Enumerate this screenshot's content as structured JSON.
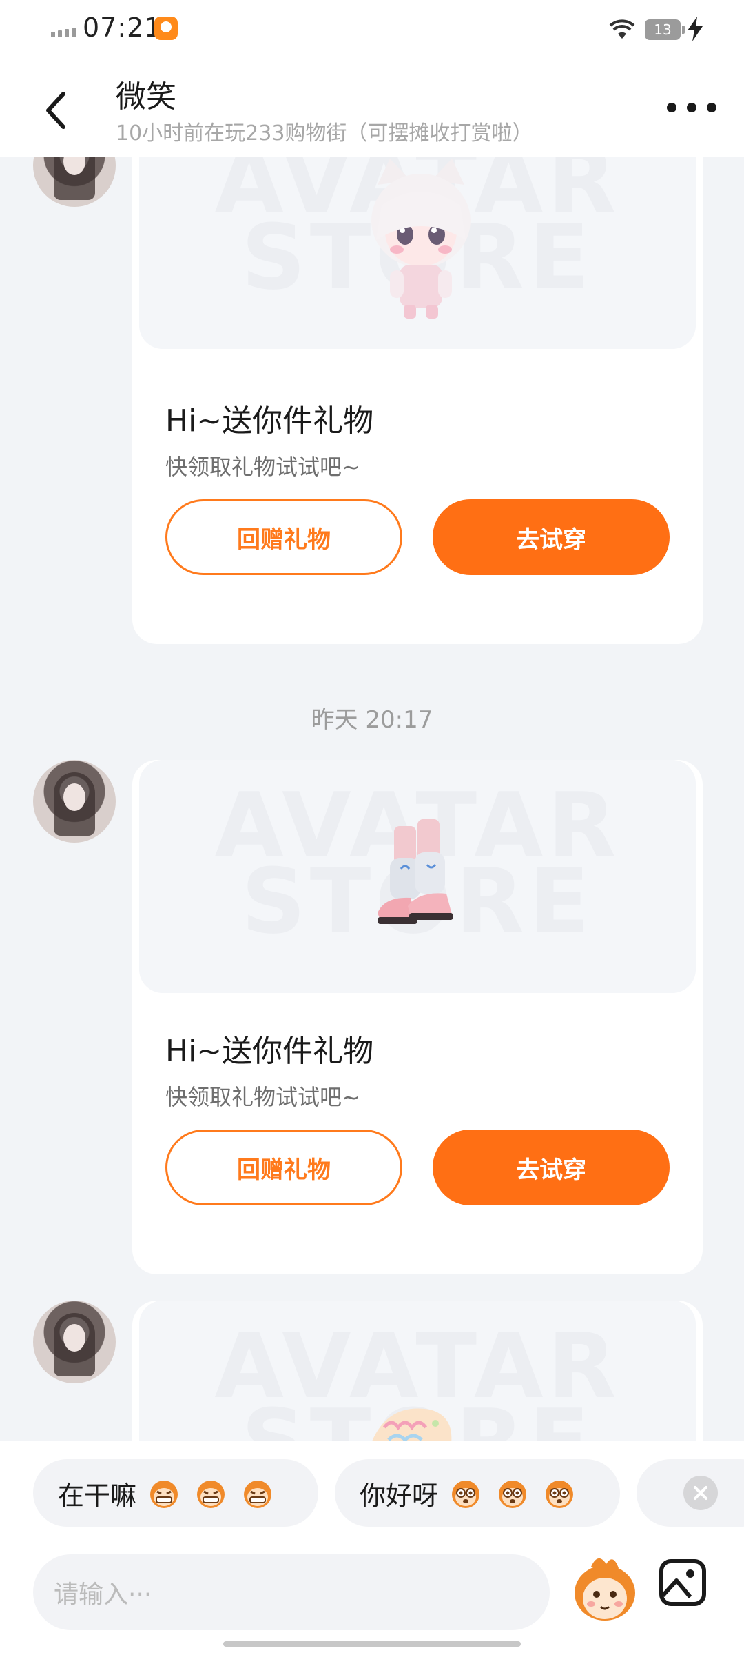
{
  "status_bar": {
    "time": "07:21",
    "battery_level": "13",
    "icons": [
      "signal-icon",
      "app-notification-icon",
      "wifi-icon",
      "battery-icon",
      "charging-icon"
    ]
  },
  "header": {
    "title": "微笑",
    "subtitle": "10小时前在玩233购物街（可摆摊收打赏啦）",
    "icons": [
      "back-icon",
      "more-icon"
    ]
  },
  "messages": [
    {
      "image_watermark": [
        "AVATAR",
        "STORE"
      ],
      "image_subject": "cat-ear-girl-avatar",
      "title": "Hi~送你件礼物",
      "description": "快领取礼物试试吧~",
      "return_gift_label": "回赠礼物",
      "try_on_label": "去试穿"
    },
    {
      "timestamp": "昨天 20:17",
      "image_watermark": [
        "AVATAR",
        "STORE"
      ],
      "image_subject": "leg-warmer-boots",
      "title": "Hi~送你件礼物",
      "description": "快领取礼物试试吧~",
      "return_gift_label": "回赠礼物",
      "try_on_label": "去试穿"
    },
    {
      "image_watermark": [
        "AVATAR",
        "STORE"
      ],
      "image_subject": "candy-fish-item"
    }
  ],
  "quick_replies": [
    {
      "text": "在干嘛",
      "emoji": "grinning-monkey-emoji"
    },
    {
      "text": "你好呀",
      "emoji": "wide-eyed-monkey-emoji"
    }
  ],
  "input": {
    "placeholder": "请输入···"
  },
  "colors": {
    "accent": "#ff6f14",
    "background": "#f2f4f7",
    "card": "#ffffff"
  }
}
